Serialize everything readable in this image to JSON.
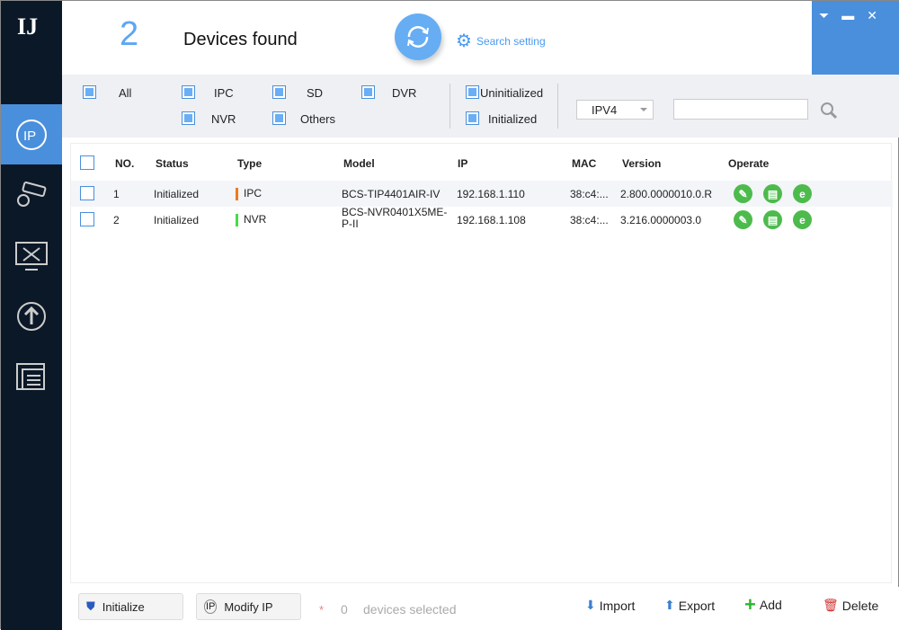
{
  "header": {
    "count": "2",
    "title": "Devices found",
    "search_setting": "Search setting"
  },
  "filters": {
    "all": "All",
    "ipc": "IPC",
    "sd": "SD",
    "dvr": "DVR",
    "nvr": "NVR",
    "others": "Others",
    "uninitialized": "Uninitialized",
    "initialized": "Initialized",
    "ip_version": "IPV4",
    "search_value": ""
  },
  "table": {
    "columns": [
      "NO.",
      "Status",
      "Type",
      "Model",
      "IP",
      "MAC",
      "Version",
      "Operate"
    ],
    "rows": [
      {
        "no": "1",
        "status": "Initialized",
        "type": "IPC",
        "type_color": "#f07820",
        "model": "BCS-TIP4401AIR-IV",
        "ip": "192.168.1.110",
        "mac": "38:c4:...",
        "version": "2.800.0000010.0.R"
      },
      {
        "no": "2",
        "status": "Initialized",
        "type": "NVR",
        "type_color": "#44dd44",
        "model": "BCS-NVR0401X5ME-P-II",
        "ip": "192.168.1.108",
        "mac": "38:c4:...",
        "version": "3.216.0000003.0"
      }
    ]
  },
  "footer": {
    "initialize": "Initialize",
    "modify_ip": "Modify IP",
    "asterisk": "*",
    "selected_count": "0",
    "selected_label": "devices selected",
    "import": "Import",
    "export": "Export",
    "add": "Add",
    "delete": "Delete"
  },
  "colors": {
    "accent": "#4a8fdc",
    "sidebar": "#0b1827",
    "operate": "#4cbb4c"
  }
}
